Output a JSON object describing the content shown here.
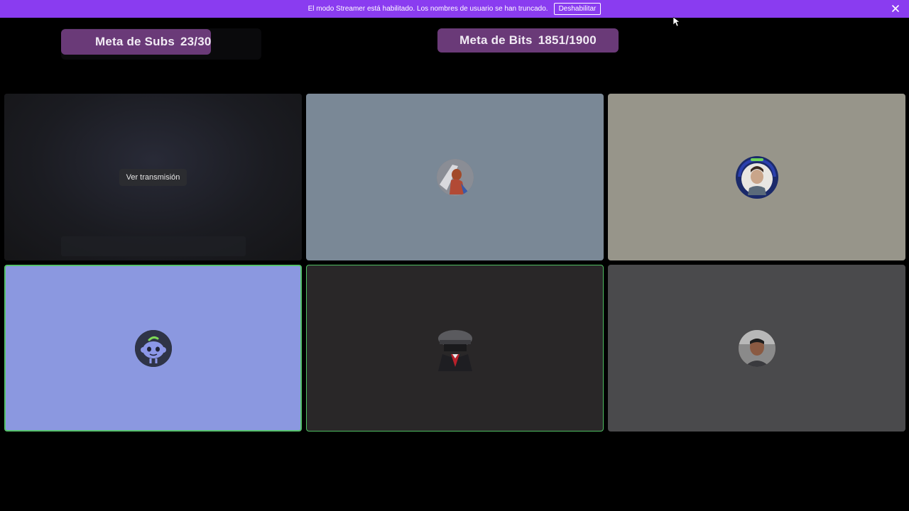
{
  "banner": {
    "message": "El modo Streamer está habilitado. Los nombres de usuario se han truncado.",
    "disable_label": "Deshabilitar",
    "close_icon": "close-icon"
  },
  "goals": {
    "subs": {
      "label": "Meta de Subs",
      "value": "23/30"
    },
    "bits": {
      "label": "Meta de Bits",
      "value": "1851/1900"
    }
  },
  "tiles": {
    "stream": {
      "watch_label": "Ver transmisión"
    }
  },
  "colors": {
    "banner": "#8a3cf0",
    "goal": "#6a3a78",
    "speaking_border": "#55c26b"
  }
}
